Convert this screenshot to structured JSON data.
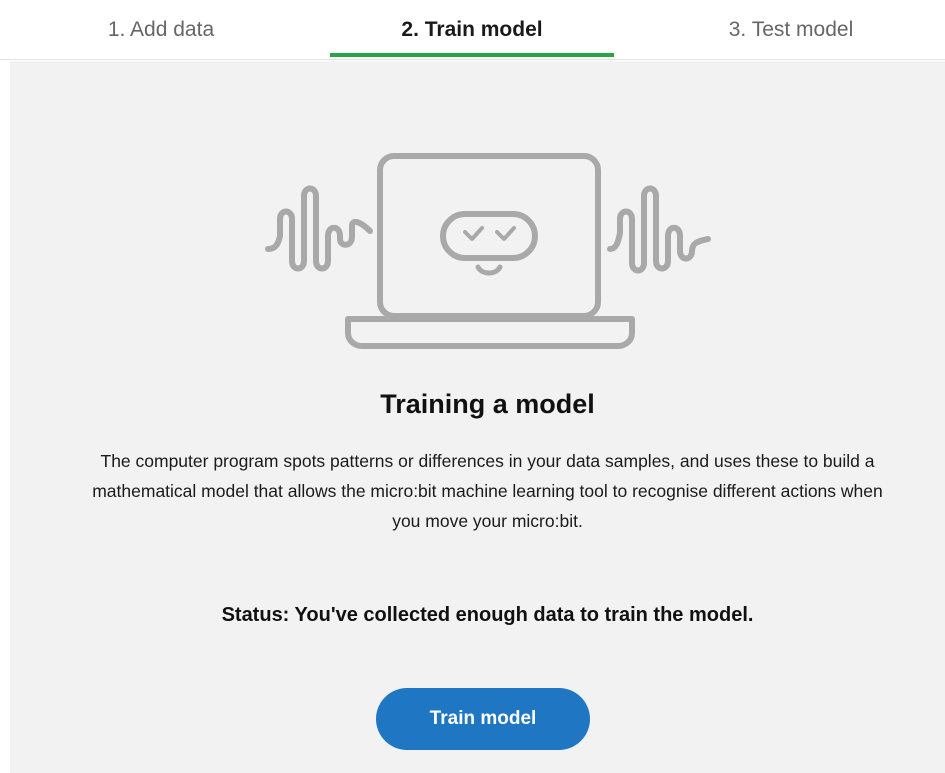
{
  "tabs": [
    {
      "label": "1. Add data",
      "active": false
    },
    {
      "label": "2. Train model",
      "active": true
    },
    {
      "label": "3. Test model",
      "active": false
    }
  ],
  "colors": {
    "active_tab_underline": "#2aa344",
    "panel_background": "#f2f2f2",
    "button_background": "#1f76c2",
    "illustration_stroke": "#a9a9a9"
  },
  "illustration": {
    "icon": "laptop-with-microbit-face-and-waves-icon"
  },
  "main": {
    "heading": "Training a model",
    "description": "The computer program spots patterns or differences in your data samples, and uses these to build a mathematical model that allows the micro:bit machine learning tool to recognise different actions when you move your micro:bit.",
    "status": "Status: You've collected enough data to train the model.",
    "train_button_label": "Train model"
  }
}
